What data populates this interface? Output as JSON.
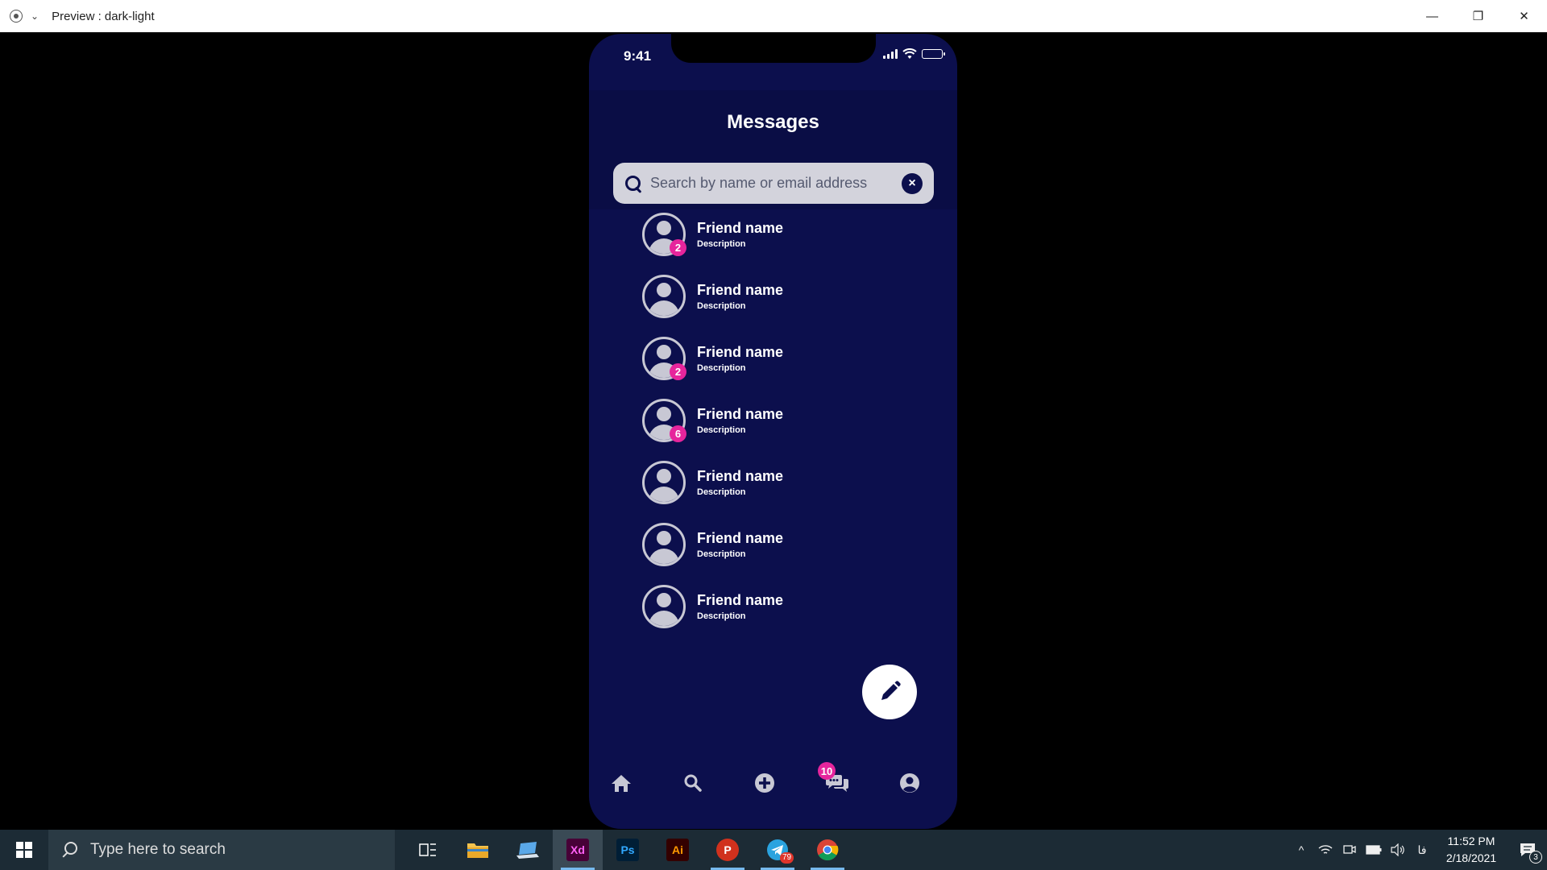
{
  "window": {
    "title": "Preview : dark-light",
    "minimize": "—",
    "maximize": "❐",
    "close": "✕"
  },
  "status_bar": {
    "time": "9:41"
  },
  "messages": {
    "title": "Messages",
    "search_placeholder": "Search by name or email address",
    "clear_icon": "×",
    "friends": [
      {
        "name": "Friend name",
        "description": "Description",
        "badge": "2"
      },
      {
        "name": "Friend name",
        "description": "Description",
        "badge": ""
      },
      {
        "name": "Friend name",
        "description": "Description",
        "badge": "2"
      },
      {
        "name": "Friend name",
        "description": "Description",
        "badge": "6"
      },
      {
        "name": "Friend name",
        "description": "Description",
        "badge": ""
      },
      {
        "name": "Friend name",
        "description": "Description",
        "badge": ""
      },
      {
        "name": "Friend name",
        "description": "Description",
        "badge": ""
      }
    ]
  },
  "bottom_nav": {
    "items": [
      "home-icon",
      "search-icon",
      "add-icon",
      "chat-icon",
      "profile-icon"
    ],
    "chat_badge": "10"
  },
  "taskbar": {
    "search_placeholder": "Type here to search",
    "apps": [
      {
        "name": "task-view",
        "label": ""
      },
      {
        "name": "file-explorer",
        "label": ""
      },
      {
        "name": "remote-desktop",
        "label": ""
      },
      {
        "name": "adobe-xd",
        "label": "Xd"
      },
      {
        "name": "photoshop",
        "label": "Ps"
      },
      {
        "name": "illustrator",
        "label": "Ai"
      },
      {
        "name": "powerpoint-like",
        "label": "P"
      },
      {
        "name": "telegram",
        "label": ""
      },
      {
        "name": "chrome",
        "label": ""
      }
    ],
    "telegram_badge": "79",
    "language": "فا",
    "clock_time": "11:52 PM",
    "clock_date": "2/18/2021",
    "notification_count": "3"
  },
  "colors": {
    "phone_bg": "#0c0f4d",
    "accent_badge": "#e6259c",
    "taskbar": "#1c2b35"
  }
}
